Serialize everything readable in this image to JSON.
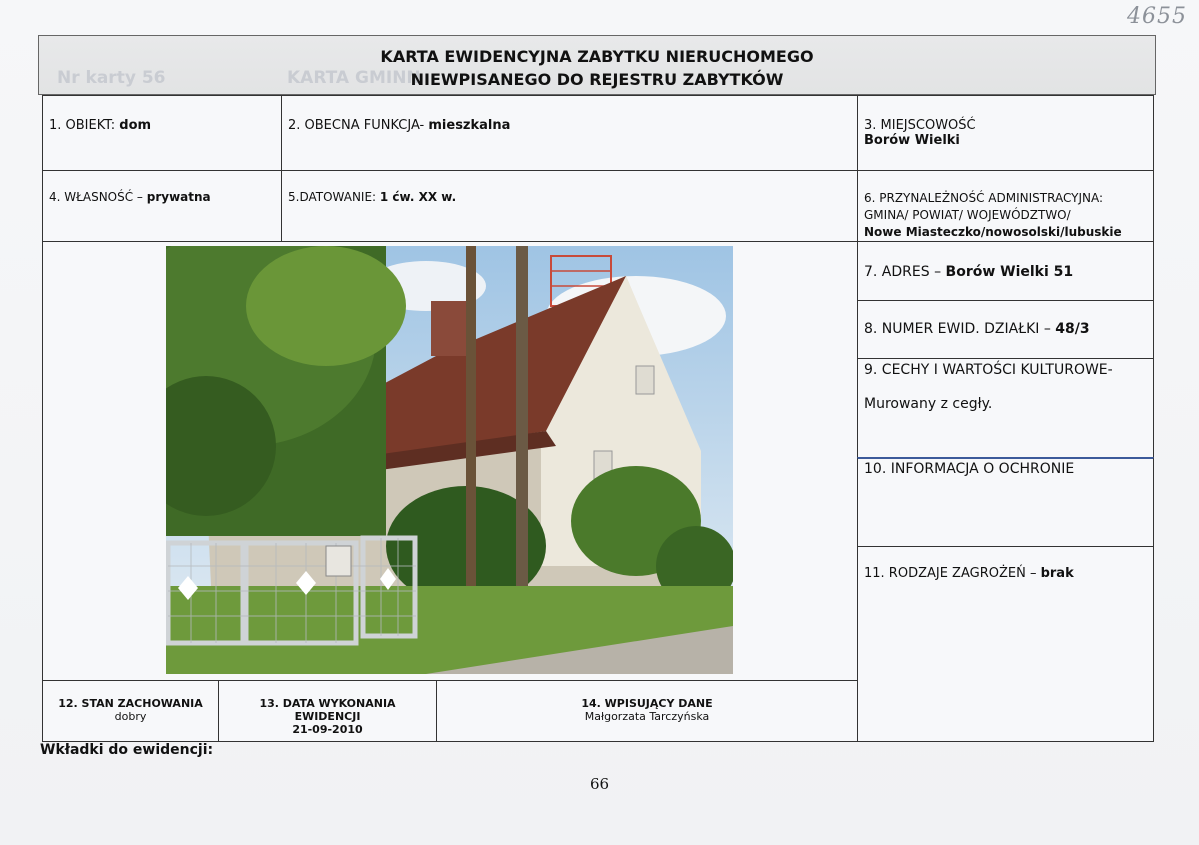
{
  "stamp": "4655",
  "header": {
    "title_line1": "KARTA EWIDENCYJNA ZABYTKU NIERUCHOMEGO",
    "title_line2": "NIEWPISANEGO DO REJESTRU ZABYTKÓW",
    "ghost_left": "Nr karty 56",
    "ghost_right": "KARTA GMINN"
  },
  "fields": {
    "obiekt": {
      "label": "1. OBIEKT: ",
      "value": "dom"
    },
    "funkcja": {
      "label": "2. OBECNA FUNKCJA- ",
      "value": "mieszkalna"
    },
    "miejscowosc": {
      "label": "3. MIEJSCOWOŚĆ",
      "value": "Borów Wielki"
    },
    "wlasnosc": {
      "label": "4. WŁASNOŚĆ – ",
      "value": "prywatna"
    },
    "datowanie": {
      "label": "5.DATOWANIE: ",
      "value": "1 ćw. XX w."
    },
    "przynaleznosc": {
      "label_line1": "6. PRZYNALEŻNOŚĆ ADMINISTRACYJNA:",
      "label_line2": "GMINA/ POWIAT/ WOJEWÓDZTWO/",
      "value": "Nowe Miasteczko/nowosolski/lubuskie"
    },
    "adres": {
      "label": "7. ADRES – ",
      "value": "Borów Wielki 51"
    },
    "dzialka": {
      "label": "8. NUMER EWID. DZIAŁKI – ",
      "value": "48/3"
    },
    "cechy": {
      "label": "9. CECHY I WARTOŚCI KULTUROWE-",
      "value": "Murowany z cegły."
    },
    "ochrona": {
      "label": "10. INFORMACJA O OCHRONIE"
    },
    "zagrozenia": {
      "label": "11. RODZAJE ZAGROŻEŃ – ",
      "value": "brak"
    },
    "stan": {
      "label": "12. STAN ZACHOWANIA",
      "value": "dobry"
    },
    "data_wykonania": {
      "label": "13. DATA WYKONANIA EWIDENCJI",
      "value": "21-09-2010"
    },
    "wpisujacy": {
      "label": "14. WPISUJĄCY DANE",
      "value": "Małgorzata Tarczyńska"
    }
  },
  "footer": {
    "wkladki": "Wkładki do ewidencji:",
    "page_number": "66"
  }
}
